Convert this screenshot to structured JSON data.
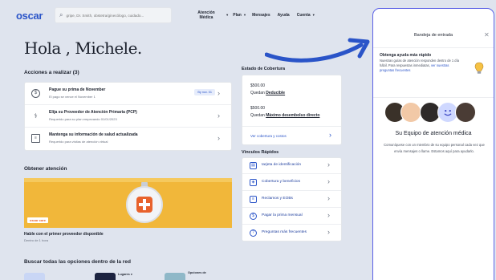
{
  "header": {
    "logo": "oscar",
    "search_placeholder": "gripe, Dr. Smith, obstetra/ginecólogo, cuidado...",
    "nav": [
      {
        "label": "Atención Médica",
        "caret": "▾"
      },
      {
        "label": "Plan",
        "caret": "▾"
      },
      {
        "label": "Mensajes",
        "caret": ""
      },
      {
        "label": "Ayuda",
        "caret": ""
      },
      {
        "label": "Cuenta",
        "caret": "▾"
      }
    ]
  },
  "greeting": "Hola , Michele.",
  "actions": {
    "title": "Acciones a realizar (3)",
    "items": [
      {
        "icon": "dollar-icon",
        "title": "Pague su prima de November",
        "subtitle": "El pago se vence el November 1",
        "badge": "By nov. 01"
      },
      {
        "icon": "stethoscope-icon",
        "title": "Elija su Proveedor de Atención Primaria (PCP)",
        "subtitle": "Requerido para su plan empezando 01/01/2023",
        "badge": ""
      },
      {
        "icon": "clipboard-icon",
        "title": "Mantenga su información de salud actualizada",
        "subtitle": "Requerido para visitas de atención virtual",
        "badge": ""
      }
    ]
  },
  "care": {
    "title": "Obtener atención",
    "banner_tag": "oscar care",
    "card_title": "Hable con el primer proveedor disponible",
    "card_subtitle": "Dentro de 1 hora"
  },
  "bottom": {
    "title": "Buscar todas las opciones dentro de la red",
    "tiles": [
      "Lugares e",
      "Opciones de"
    ]
  },
  "coverage": {
    "title": "Estado de Cobertura",
    "rows": [
      {
        "amount": "$500.00",
        "prefix": "Quedan",
        "label": "Deducible"
      },
      {
        "amount": "$500.00",
        "prefix": "Quedan",
        "label": "Máximo desembolso directo"
      }
    ],
    "link": "Ver cobertura y costos"
  },
  "quick_links": {
    "title": "Vínculos Rápidos",
    "items": [
      {
        "icon": "id-card-icon",
        "label": "tarjeta de identificación"
      },
      {
        "icon": "shield-icon",
        "label": "Cobertura y beneficios"
      },
      {
        "icon": "document-icon",
        "label": "Reclamos y EOBs"
      },
      {
        "icon": "dollar-icon",
        "label": "Pagar la prima mensual"
      },
      {
        "icon": "question-icon",
        "label": "Preguntas más frecuentes"
      }
    ]
  },
  "drawer": {
    "title": "Bandeja de entrada",
    "help_title": "Obtenga ayuda más rápido",
    "help_text": "Nuestras guías de atención responden dentro de 1 día hábil. Para respuestas inmediatas,",
    "help_link": "ver nuestras preguntas frecuentes",
    "team_title": "Su Equipo de atención médica",
    "team_text": "Comuníquese con un miembro de su equipo personal cada vez que envía mensajes o llame. Estamos aquí para ayudarlo."
  },
  "colors": {
    "brand": "#2a54c8",
    "drawer_border": "#5b61e6",
    "banner": "#f1b73a",
    "cross": "#e8622c"
  }
}
